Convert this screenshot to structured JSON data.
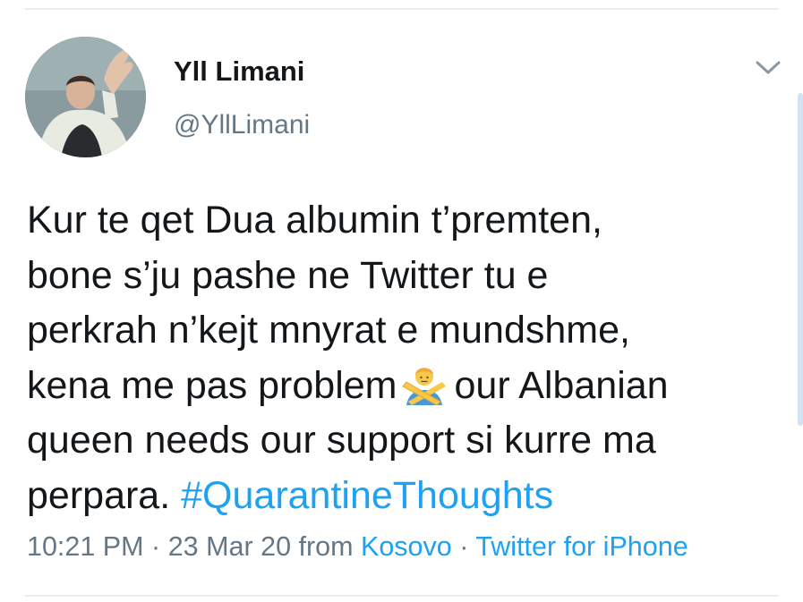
{
  "tweet": {
    "author": {
      "display_name": "Yll Limani",
      "handle": "@YllLimani",
      "avatar_icon": "avatar-photo"
    },
    "menu_icon": "chevron-down-icon",
    "text_lines": {
      "l1": "Kur te qet Dua albumin t’premten,",
      "l2": "bone s’ju pashe ne Twitter tu e",
      "l3": "perkrah n’kejt mnyrat e mundshme,",
      "l4a": "kena me pas problem",
      "emoji": "person-gesturing-no-emoji",
      "l4b": "our Albanian",
      "l5": "queen needs our support si kurre ma",
      "l6a": "perpara.",
      "hashtag": "#QuarantineThoughts"
    },
    "meta": {
      "time": "10:21 PM",
      "sep1": "·",
      "date": "23 Mar 20",
      "from": "from",
      "location": "Kosovo",
      "sep2": "·",
      "source": "Twitter for iPhone"
    }
  },
  "colors": {
    "text": "#14171a",
    "secondary": "#657786",
    "link": "#1da1f2",
    "divider": "#e6ecf0"
  }
}
